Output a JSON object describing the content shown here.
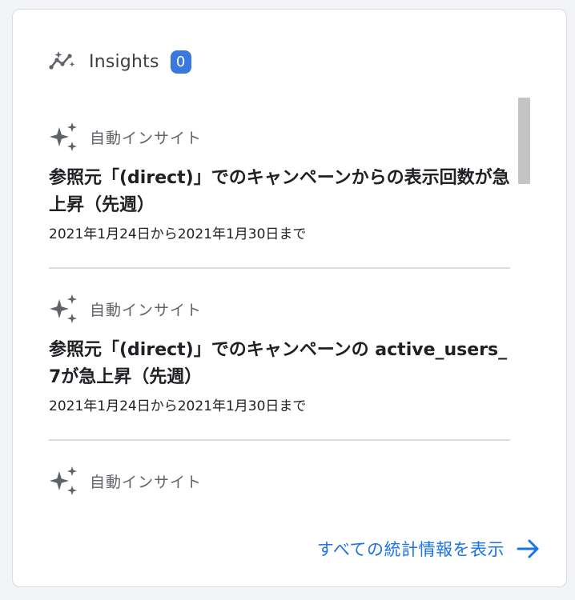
{
  "header": {
    "icon": "insights-trend-icon",
    "title": "Insights",
    "count": "0"
  },
  "insights": [
    {
      "icon": "sparkle-icon",
      "label": "自動インサイト",
      "title": "参照元「(direct)」でのキャンペーンからの表示回数が急上昇（先週）",
      "date": "2021年1月24日から2021年1月30日まで"
    },
    {
      "icon": "sparkle-icon",
      "label": "自動インサイト",
      "title": "参照元「(direct)」でのキャンペーンの active_users_7が急上昇（先週）",
      "date": "2021年1月24日から2021年1月30日まで"
    },
    {
      "icon": "sparkle-icon",
      "label": "自動インサイト"
    }
  ],
  "footer": {
    "link_label": "すべての統計情報を表示",
    "icon": "arrow-right-icon"
  },
  "colors": {
    "accent": "#1a73e8",
    "badge": "#3a78e0",
    "icon": "#5f6368",
    "divider": "#dadce0"
  }
}
